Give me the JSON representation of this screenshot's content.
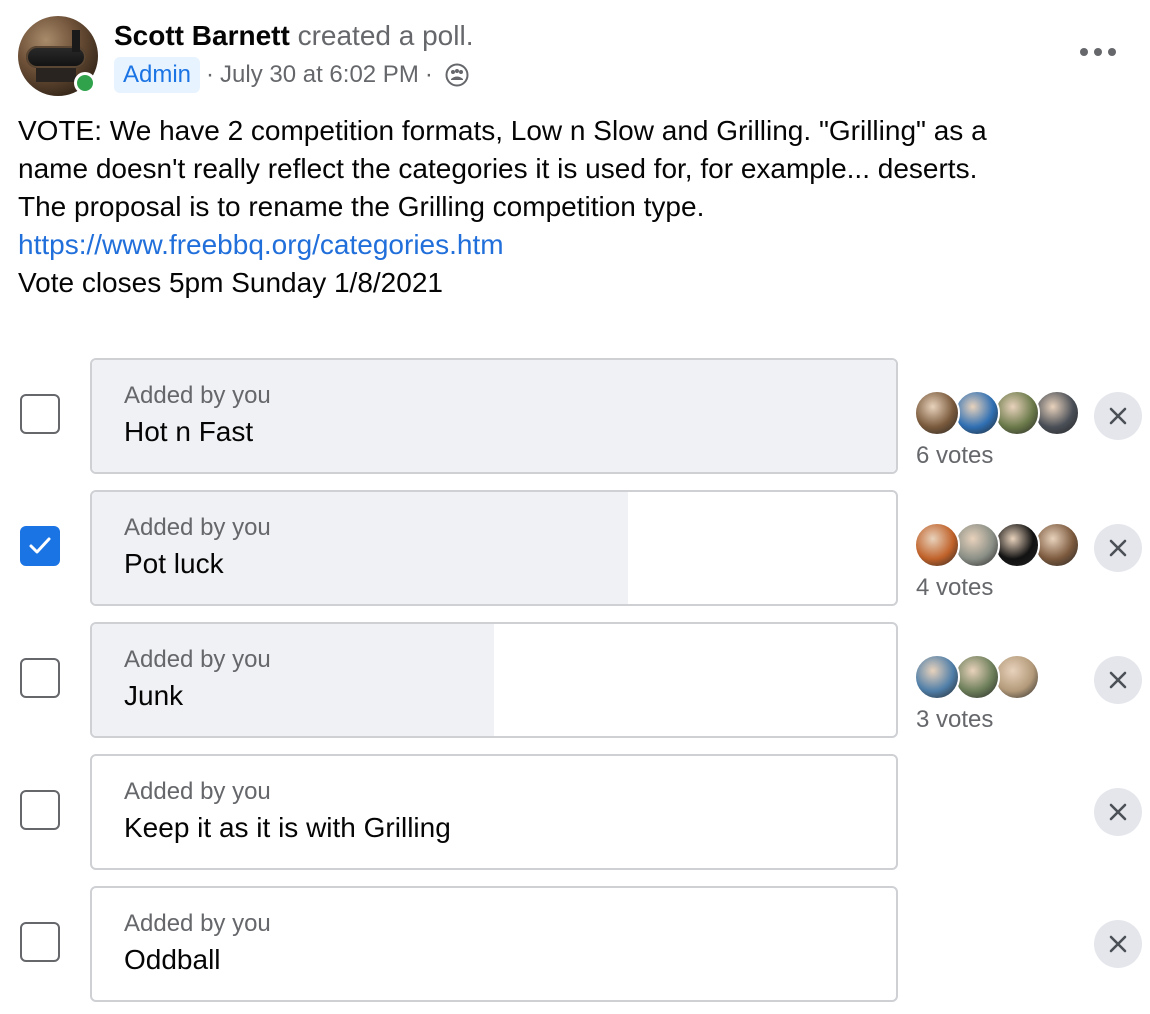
{
  "post": {
    "author": "Scott Barnett",
    "action": "created a poll.",
    "badge": "Admin",
    "timestamp": "July 30 at 6:02 PM",
    "separator": "·",
    "privacy_icon": "group-icon",
    "menu_icon": "more-horizontal-icon",
    "body_lines": [
      "VOTE: We have 2 competition formats, Low n Slow and Grilling. \"Grilling\" as a",
      "name doesn't really reflect the categories it is used for, for example... deserts.",
      "The proposal is to rename the Grilling competition type."
    ],
    "link": "https://www.freebbq.org/categories.htm",
    "closing_line": "Vote closes 5pm Sunday 1/8/2021"
  },
  "poll": {
    "options": [
      {
        "added_by": "Added by you",
        "label": "Hot n Fast",
        "checked": false,
        "fill_fraction": 1.0,
        "votes_text": "6 votes",
        "voter_colors": [
          "#7a5a3c",
          "#2f6fb3",
          "#6b7a4a",
          "#4a4f57"
        ]
      },
      {
        "added_by": "Added by you",
        "label": "Pot luck",
        "checked": true,
        "fill_fraction": 0.667,
        "votes_text": "4 votes",
        "voter_colors": [
          "#c0622a",
          "#8a8f86",
          "#121212",
          "#7c5a3e"
        ]
      },
      {
        "added_by": "Added by you",
        "label": "Junk",
        "checked": false,
        "fill_fraction": 0.5,
        "votes_text": "3 votes",
        "voter_colors": [
          "#4f7ea8",
          "#6d7f5a",
          "#b39a7a"
        ]
      },
      {
        "added_by": "Added by you",
        "label": "Keep it as it is with Grilling",
        "checked": false,
        "fill_fraction": 0,
        "votes_text": "",
        "voter_colors": []
      },
      {
        "added_by": "Added by you",
        "label": "Oddball",
        "checked": false,
        "fill_fraction": 0,
        "votes_text": "",
        "voter_colors": []
      }
    ],
    "check_icon": "checkmark-icon",
    "remove_icon": "close-icon",
    "colors": {
      "accent": "#1b74e4",
      "fill": "#eff1f4",
      "border": "#ced0d4"
    }
  }
}
